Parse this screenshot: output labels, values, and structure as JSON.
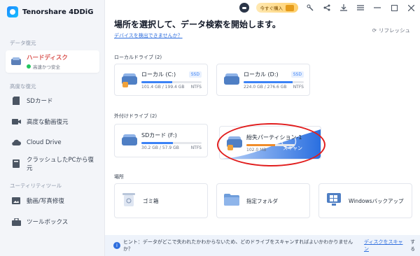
{
  "app": {
    "name": "Tenorshare 4DDiG"
  },
  "titlebar": {
    "buy_label": "今すぐ購入"
  },
  "sidebar": {
    "section_recovery": "データ復元",
    "hard_disk": {
      "label": "ハードディスク",
      "status": "高速かつ安全"
    },
    "section_advanced": "高度な復元",
    "advanced_items": [
      {
        "label": "SDカード",
        "icon": "sd-card-icon"
      },
      {
        "label": "高度な動画復元",
        "icon": "video-icon"
      },
      {
        "label": "Cloud Drive",
        "icon": "cloud-icon"
      },
      {
        "label": "クラッシュしたPCから復元",
        "icon": "computer-icon"
      }
    ],
    "section_utility": "ユーティリティツール",
    "utility_items": [
      {
        "label": "動画/写真修復",
        "icon": "photo-repair-icon"
      },
      {
        "label": "ツールボックス",
        "icon": "toolbox-icon"
      }
    ]
  },
  "main": {
    "title": "場所を選択して、データ検索を開始します。",
    "detect_link": "デバイスを検出できませんか？",
    "refresh": "リフレッシュ",
    "local_label": "ローカルドライブ (2)",
    "local_drives": [
      {
        "name": "ローカル (C:)",
        "badge": "SSD",
        "size": "101.4 GB / 199.4 GB",
        "fs": "NTFS",
        "used_fraction": 0.51
      },
      {
        "name": "ローカル (D:)",
        "badge": "SSD",
        "size": "224.0 GB / 276.6 GB",
        "fs": "NTFS",
        "used_fraction": 0.81
      }
    ],
    "external_label": "外付けドライブ (2)",
    "external_drives": [
      {
        "name": "SDカード (F:)",
        "size": "30.2 GB / 57.9 GB",
        "fs": "NTFS",
        "used_fraction": 0.52
      },
      {
        "name": "紛失パーティション-1",
        "size": "102.0 MB",
        "scan_label": "スキャン",
        "used_fraction": 0.6
      }
    ],
    "locations_label": "場所",
    "locations": [
      {
        "label": "ゴミ箱",
        "icon": "trash-icon"
      },
      {
        "label": "指定フォルダ",
        "icon": "folder-icon"
      },
      {
        "label": "Windowsバックアップ",
        "icon": "windows-backup-icon"
      }
    ]
  },
  "tip": {
    "text": "ヒント：データがどこで失われたかわからないため、どのドライブをスキャンすればよいかわかりませんか？",
    "link": "ディスクをスキャン",
    "tail": "する"
  },
  "colors": {
    "accent": "#2f6fde",
    "active_nav": "#d9534f",
    "highlight_oval": "#e11d1d"
  }
}
